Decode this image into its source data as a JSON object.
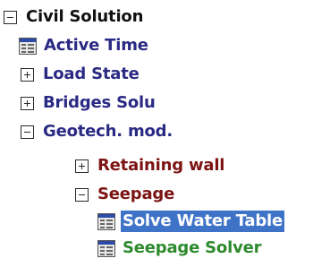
{
  "tree": {
    "items": [
      {
        "label": "Civil Solution",
        "toggle": "minus",
        "color": "#111111"
      },
      {
        "label": "Active Time",
        "icon": "table-doc-icon",
        "color": "#2a2a84"
      },
      {
        "label": "Load State",
        "toggle": "plus",
        "color": "#2a2a84"
      },
      {
        "label": "Bridges Solu",
        "toggle": "plus",
        "color": "#2a2a84"
      },
      {
        "label": "Geotech. mod.",
        "toggle": "minus",
        "color": "#2a2a84"
      },
      {
        "label": "Retaining wall",
        "toggle": "plus",
        "color": "#7c1414"
      },
      {
        "label": "Seepage",
        "toggle": "minus",
        "color": "#7c1414"
      },
      {
        "label": "Solve Water Table",
        "icon": "table-doc-icon",
        "color": "#2a2a84",
        "selected": true,
        "selection_color": "#3f73c8"
      },
      {
        "label": "Seepage Solver",
        "icon": "table-doc-icon",
        "color": "#2d8a2d"
      }
    ]
  }
}
